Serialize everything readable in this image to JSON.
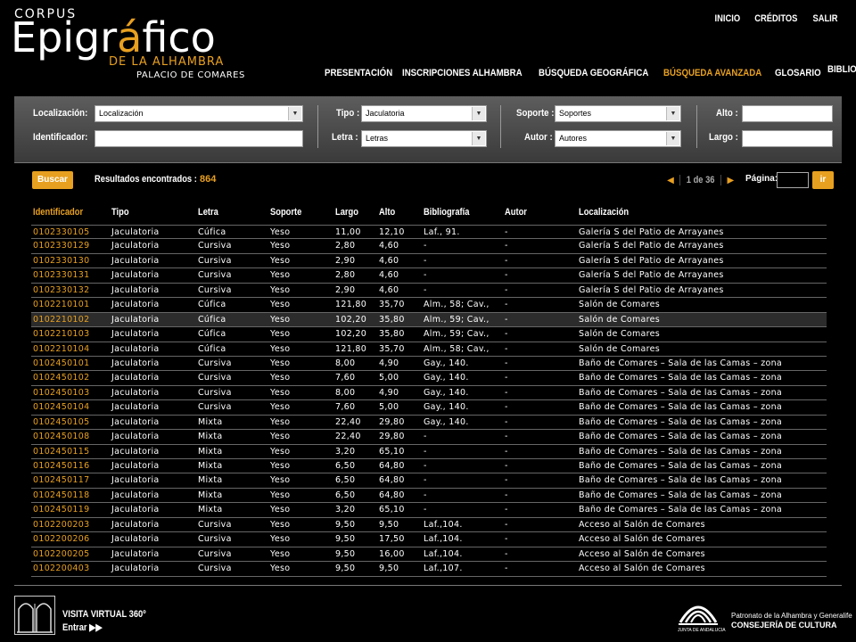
{
  "logo": {
    "corpus": "CORPUS",
    "main_pre": "Epigr",
    "main_accent": "á",
    "main_post": "fico",
    "sub": "DE LA ALHAMBRA",
    "palace": "PALACIO DE COMARES"
  },
  "top_links": [
    "INICIO",
    "CRÉDITOS",
    "SALIR"
  ],
  "nav": {
    "items": [
      "PRESENTACIÓN",
      "INSCRIPCIONES ALHAMBRA",
      "BÚSQUEDA GEOGRÁFICA",
      "BÚSQUEDA AVANZADA",
      "GLOSARIO",
      "BIBLIOGRAFÍA"
    ],
    "active": "BÚSQUEDA AVANZADA"
  },
  "search": {
    "localizacion_label": "Localización:",
    "localizacion_value": "Localización",
    "identificador_label": "Identificador:",
    "identificador_value": "",
    "tipo_label": "Tipo :",
    "tipo_value": "Jaculatoria",
    "letra_label": "Letra :",
    "letra_value": "Letras",
    "soporte_label": "Soporte :",
    "soporte_value": "Soportes",
    "autor_label": "Autor :",
    "autor_value": "Autores",
    "alto_label": "Alto :",
    "alto_value": "",
    "largo_label": "Largo :",
    "largo_value": ""
  },
  "results": {
    "buscar_label": "Buscar",
    "found_label": "Resultados encontrados :",
    "count": "864",
    "pages": "1 de 36",
    "page_label": "Página:",
    "page_value": "",
    "go_label": "ir"
  },
  "table": {
    "headers": [
      "Identificador",
      "Tipo",
      "Letra",
      "Soporte",
      "Largo",
      "Alto",
      "Bibliografía",
      "Autor",
      "Localización"
    ],
    "rows": [
      [
        "0102330105",
        "Jaculatoria",
        "Cúfica",
        "Yeso",
        "11,00",
        "12,10",
        "Laf., 91.",
        "-",
        "Galería S del Patio de Arrayanes"
      ],
      [
        "0102330129",
        "Jaculatoria",
        "Cursiva",
        "Yeso",
        "2,80",
        "4,60",
        "-",
        "-",
        "Galería S del Patio de Arrayanes"
      ],
      [
        "0102330130",
        "Jaculatoria",
        "Cursiva",
        "Yeso",
        "2,90",
        "4,60",
        "-",
        "-",
        "Galería S del Patio de Arrayanes"
      ],
      [
        "0102330131",
        "Jaculatoria",
        "Cursiva",
        "Yeso",
        "2,80",
        "4,60",
        "-",
        "-",
        "Galería S del Patio de Arrayanes"
      ],
      [
        "0102330132",
        "Jaculatoria",
        "Cursiva",
        "Yeso",
        "2,90",
        "4,60",
        "-",
        "-",
        "Galería S del Patio de Arrayanes"
      ],
      [
        "0102210101",
        "Jaculatoria",
        "Cúfica",
        "Yeso",
        "121,80",
        "35,70",
        "Alm., 58; Cav.,",
        "-",
        "Salón de Comares"
      ],
      [
        "0102210102",
        "Jaculatoria",
        "Cúfica",
        "Yeso",
        "102,20",
        "35,80",
        "Alm., 59; Cav.,",
        "-",
        "Salón de Comares"
      ],
      [
        "0102210103",
        "Jaculatoria",
        "Cúfica",
        "Yeso",
        "102,20",
        "35,80",
        "Alm., 59; Cav.,",
        "-",
        "Salón de Comares"
      ],
      [
        "0102210104",
        "Jaculatoria",
        "Cúfica",
        "Yeso",
        "121,80",
        "35,70",
        "Alm., 58; Cav.,",
        "-",
        "Salón de Comares"
      ],
      [
        "0102450101",
        "Jaculatoria",
        "Cursiva",
        "Yeso",
        "8,00",
        "4,90",
        "Gay., 140.",
        "-",
        "Baño de Comares – Sala de las Camas – zona"
      ],
      [
        "0102450102",
        "Jaculatoria",
        "Cursiva",
        "Yeso",
        "7,60",
        "5,00",
        "Gay., 140.",
        "-",
        "Baño de Comares – Sala de las Camas – zona"
      ],
      [
        "0102450103",
        "Jaculatoria",
        "Cursiva",
        "Yeso",
        "8,00",
        "4,90",
        "Gay., 140.",
        "-",
        "Baño de Comares – Sala de las Camas – zona"
      ],
      [
        "0102450104",
        "Jaculatoria",
        "Cursiva",
        "Yeso",
        "7,60",
        "5,00",
        "Gay., 140.",
        "-",
        "Baño de Comares – Sala de las Camas – zona"
      ],
      [
        "0102450105",
        "Jaculatoria",
        "Mixta",
        "Yeso",
        "22,40",
        "29,80",
        "Gay., 140.",
        "-",
        "Baño de Comares – Sala de las Camas – zona"
      ],
      [
        "0102450108",
        "Jaculatoria",
        "Mixta",
        "Yeso",
        "22,40",
        "29,80",
        "-",
        "-",
        "Baño de Comares – Sala de las Camas – zona"
      ],
      [
        "0102450115",
        "Jaculatoria",
        "Mixta",
        "Yeso",
        "3,20",
        "65,10",
        "-",
        "-",
        "Baño de Comares – Sala de las Camas – zona"
      ],
      [
        "0102450116",
        "Jaculatoria",
        "Mixta",
        "Yeso",
        "6,50",
        "64,80",
        "-",
        "-",
        "Baño de Comares – Sala de las Camas – zona"
      ],
      [
        "0102450117",
        "Jaculatoria",
        "Mixta",
        "Yeso",
        "6,50",
        "64,80",
        "-",
        "-",
        "Baño de Comares – Sala de las Camas – zona"
      ],
      [
        "0102450118",
        "Jaculatoria",
        "Mixta",
        "Yeso",
        "6,50",
        "64,80",
        "-",
        "-",
        "Baño de Comares – Sala de las Camas – zona"
      ],
      [
        "0102450119",
        "Jaculatoria",
        "Mixta",
        "Yeso",
        "3,20",
        "65,10",
        "-",
        "-",
        "Baño de Comares – Sala de las Camas – zona"
      ],
      [
        "0102200203",
        "Jaculatoria",
        "Cursiva",
        "Yeso",
        "9,50",
        "9,50",
        "Laf.,104.",
        "-",
        "Acceso al Salón de Comares"
      ],
      [
        "0102200206",
        "Jaculatoria",
        "Cursiva",
        "Yeso",
        "9,50",
        "17,50",
        "Laf.,104.",
        "-",
        "Acceso al Salón de Comares"
      ],
      [
        "0102200205",
        "Jaculatoria",
        "Cursiva",
        "Yeso",
        "9,50",
        "16,00",
        "Laf.,104.",
        "-",
        "Acceso al Salón de Comares"
      ],
      [
        "0102200403",
        "Jaculatoria",
        "Cursiva",
        "Yeso",
        "9,50",
        "9,50",
        "Laf.,107.",
        "-",
        "Acceso al Salón de Comares"
      ]
    ],
    "highlighted_row": 6
  },
  "footer": {
    "virtual_title": "VISITA VIRTUAL 360º",
    "virtual_enter": "Entrar",
    "junta_caption": "JUNTA DE ANDALUCIA",
    "patronato": "Patronato de la Alhambra y Generalife",
    "consejeria": "CONSEJERÍA DE CULTURA"
  },
  "colors": {
    "accent": "#e8a020",
    "background": "#000000",
    "panel": "#4a4a4a"
  }
}
